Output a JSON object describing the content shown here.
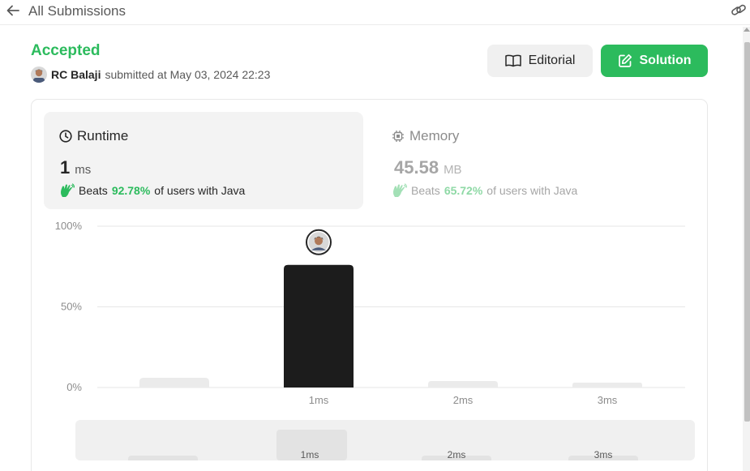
{
  "header": {
    "back_label": "All Submissions"
  },
  "submission": {
    "status": "Accepted",
    "author": "RC Balaji",
    "submitted_text": "submitted at May 03, 2024 22:23"
  },
  "actions": {
    "editorial_label": "Editorial",
    "solution_label": "Solution"
  },
  "runtime": {
    "title": "Runtime",
    "value": "1",
    "unit": "ms",
    "beats_prefix": "Beats",
    "beats_pct": "92.78%",
    "beats_suffix": "of users with Java"
  },
  "memory": {
    "title": "Memory",
    "value": "45.58",
    "unit": "MB",
    "beats_prefix": "Beats",
    "beats_pct": "65.72%",
    "beats_suffix": "of users with Java"
  },
  "chart_data": {
    "type": "bar",
    "categories": [
      "",
      "1ms",
      "2ms",
      "3ms"
    ],
    "values": [
      6,
      76,
      4,
      3
    ],
    "highlight_index": 1,
    "y_ticks": [
      "0%",
      "50%",
      "100%"
    ],
    "ylim": [
      0,
      100
    ],
    "grid": true,
    "colors": {
      "bar": "#ebebeb",
      "highlight": "#1c1c1c",
      "grid": "#e6e6e6"
    }
  },
  "minimap": {
    "labels": [
      "1ms",
      "2ms",
      "3ms"
    ],
    "values": [
      6,
      76,
      4,
      3
    ]
  },
  "colors": {
    "accent": "#2cbb5d",
    "card_bg": "#f3f3f3"
  }
}
